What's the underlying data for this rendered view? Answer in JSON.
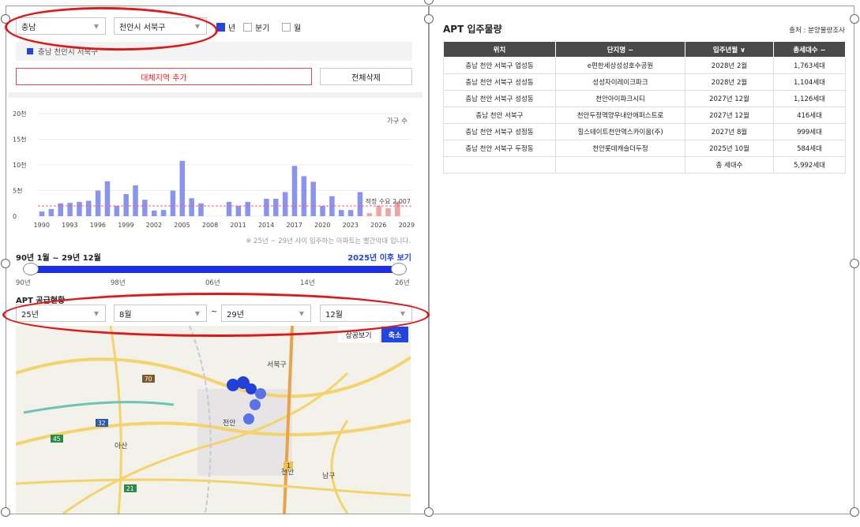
{
  "filters": {
    "region": "충남",
    "district": "천안시 서북구",
    "period_options": [
      {
        "label": "년",
        "checked": true
      },
      {
        "label": "분기",
        "checked": false
      },
      {
        "label": "월",
        "checked": false
      }
    ]
  },
  "selected_region_label": "충남 천안시 서북구",
  "buttons": {
    "add_region": "대체지역 추가",
    "delete_all": "전체삭제",
    "view_after": "2025년 이후 보기",
    "map_view": "상공보기",
    "zoom_out": "축소"
  },
  "colors": {
    "accent": "#2345e0",
    "future_bar": "#f2a0a0",
    "past_bar": "#8a93ef",
    "highlight_ring": "#e01818"
  },
  "chart_data": {
    "type": "bar",
    "legend": "가구 수",
    "y_ticks": [
      "0",
      "5천",
      "10천",
      "15천",
      "20천"
    ],
    "ylim": [
      0,
      20000
    ],
    "x_ticks": [
      "1990",
      "1993",
      "1996",
      "1999",
      "2002",
      "2005",
      "2008",
      "2011",
      "2014",
      "2017",
      "2020",
      "2023",
      "2026",
      "2029"
    ],
    "reference_line": {
      "label": "적정 수요 2,007",
      "value": 2007
    },
    "categories": [
      1990,
      1991,
      1992,
      1993,
      1994,
      1995,
      1996,
      1997,
      1998,
      1999,
      2000,
      2001,
      2002,
      2003,
      2004,
      2005,
      2006,
      2007,
      2008,
      2009,
      2010,
      2011,
      2012,
      2013,
      2014,
      2015,
      2016,
      2017,
      2018,
      2019,
      2020,
      2021,
      2022,
      2023,
      2024,
      2025,
      2026,
      2027,
      2028,
      2029
    ],
    "values": [
      900,
      1400,
      2500,
      2600,
      2800,
      3000,
      5000,
      6800,
      2000,
      4300,
      6000,
      3200,
      1100,
      1200,
      5000,
      10800,
      3500,
      2500,
      0,
      0,
      2800,
      2000,
      2800,
      0,
      3400,
      3400,
      4700,
      9800,
      7800,
      6700,
      2000,
      3900,
      1200,
      1200,
      4700,
      584,
      2007,
      1542,
      2867,
      0
    ],
    "future_from": 2025,
    "note": "※ 25년 ~ 29년 사이 입주하는 아파트는 빨간막대 입니다."
  },
  "range": {
    "label": "90년 1월 ~ 29년 12월",
    "ticks": [
      "90년",
      "98년",
      "06년",
      "14년",
      "26년"
    ]
  },
  "supply": {
    "label": "APT 공급현황",
    "from_year": "25년",
    "from_month": "8월",
    "tilde": "~",
    "to_year": "29년",
    "to_month": "12월"
  },
  "map": {
    "labels": [
      "서북구",
      "천안",
      "아산",
      "천안",
      "남구"
    ],
    "road_numbers": [
      "70",
      "32",
      "45",
      "21",
      "1"
    ]
  },
  "table": {
    "title": "APT 입주물량",
    "source": "출처 : 분양물량조사",
    "headers": [
      "위치",
      "단지명 −",
      "입주년월 ∨",
      "총세대수 −"
    ],
    "rows": [
      [
        "충남 천안 서북구 업성동",
        "e편한세상성성호수공원",
        "2028년 2월",
        "1,763세대"
      ],
      [
        "충남 천안 서북구 성성동",
        "성성자이레이크파크",
        "2028년 2월",
        "1,104세대"
      ],
      [
        "충남 천안 서북구 성성동",
        "천안아이파크시티",
        "2027년 12월",
        "1,126세대"
      ],
      [
        "충남 천안 서북구",
        "천안두정역양우내안애퍼스트로",
        "2027년 12월",
        "416세대"
      ],
      [
        "충남 천안 서북구 성정동",
        "힐스테이트천안역스카이움(주)",
        "2027년 8월",
        "999세대"
      ],
      [
        "충남 천안 서북구 두정동",
        "천안롯데캐슬더두정",
        "2025년 10월",
        "584세대"
      ]
    ],
    "total_label": "총 세대수",
    "total_value": "5,992세대"
  }
}
